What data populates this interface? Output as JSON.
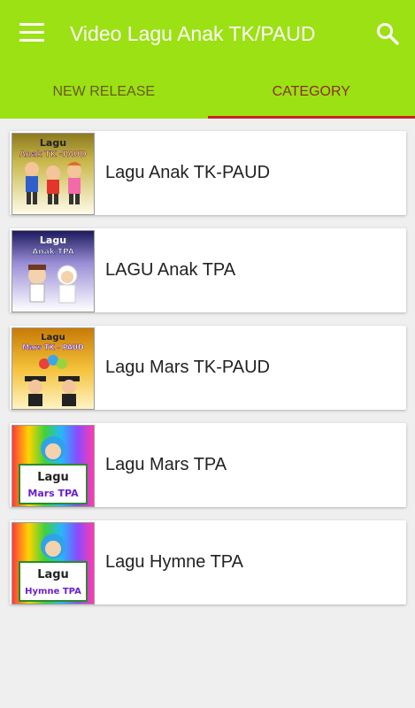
{
  "app": {
    "title": "Video Lagu Anak TK/PAUD"
  },
  "tabs": [
    {
      "label": "NEW RELEASE"
    },
    {
      "label": "CATEGORY"
    }
  ],
  "items": [
    {
      "label": "Lagu Anak TK-PAUD",
      "thumb_text_1": "Lagu",
      "thumb_text_2": "Anak TK -PAUD"
    },
    {
      "label": "LAGU Anak TPA",
      "thumb_text_1": "Lagu",
      "thumb_text_2": "Anak TPA"
    },
    {
      "label": "Lagu Mars TK-PAUD",
      "thumb_text_1": "Lagu",
      "thumb_text_2": "Mars TK - PAUD"
    },
    {
      "label": "Lagu Mars TPA",
      "thumb_text_1": "Lagu",
      "thumb_text_2": "Mars TPA"
    },
    {
      "label": "Lagu Hymne TPA",
      "thumb_text_1": "Lagu",
      "thumb_text_2": "Hymne TPA"
    }
  ],
  "colors": {
    "appbar": "#9be113",
    "tab_indicator": "#c8261f",
    "background": "#efefef"
  },
  "icons": {
    "menu": "hamburger-menu-icon",
    "search": "search-icon"
  }
}
